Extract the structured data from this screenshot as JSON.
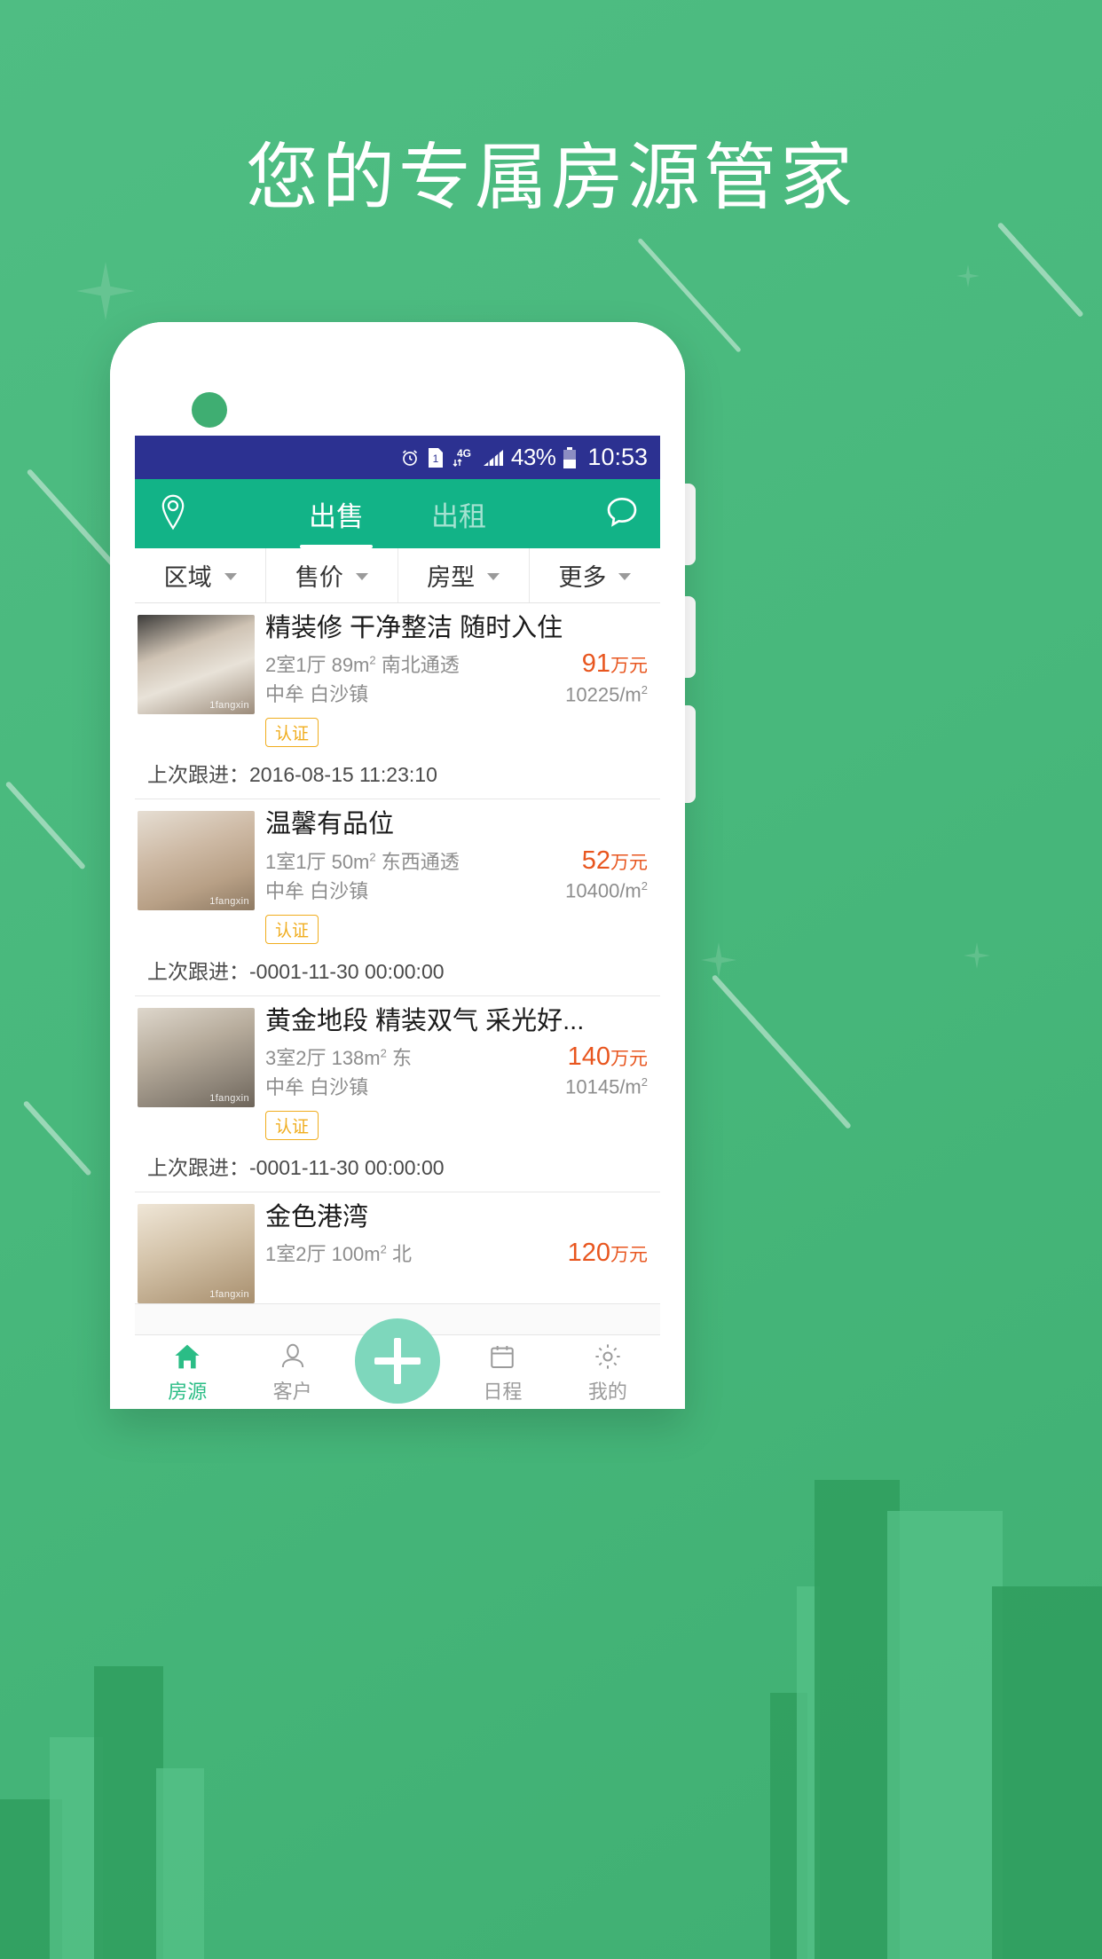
{
  "promo": {
    "headline": "您的专属房源管家"
  },
  "statusbar": {
    "alarm_icon": "alarm-clock-icon",
    "sim_icon": "sim-card-1-icon",
    "network_label": "4G",
    "signal_icon": "signal-bars-icon",
    "battery_percent": "43%",
    "battery_icon": "battery-icon",
    "time": "10:53"
  },
  "appbar": {
    "location_icon": "map-pin-icon",
    "message_icon": "chat-bubble-icon",
    "tabs": [
      {
        "label": "出售",
        "active": true
      },
      {
        "label": "出租",
        "active": false
      }
    ]
  },
  "filters": [
    {
      "label": "区域",
      "icon": "chevron-down-icon"
    },
    {
      "label": "售价",
      "icon": "chevron-down-icon"
    },
    {
      "label": "房型",
      "icon": "chevron-down-icon"
    },
    {
      "label": "更多",
      "icon": "chevron-down-icon"
    }
  ],
  "listings": [
    {
      "title": "精装修 干净整洁 随时入住",
      "spec": "2室1厅 89m",
      "spec_sup": "2",
      "spec_tail": " 南北通透",
      "price": "91",
      "price_unit": "万元",
      "location": "中牟 白沙镇",
      "unit_price": "10225/m",
      "unit_price_sup": "2",
      "badge": "认证",
      "watermark": "1fangxin",
      "followup": "上次跟进：2016-08-15 11:23:10"
    },
    {
      "title": "温馨有品位",
      "spec": "1室1厅 50m",
      "spec_sup": "2",
      "spec_tail": " 东西通透",
      "price": "52",
      "price_unit": "万元",
      "location": "中牟 白沙镇",
      "unit_price": "10400/m",
      "unit_price_sup": "2",
      "badge": "认证",
      "watermark": "1fangxin",
      "followup": "上次跟进：-0001-11-30 00:00:00"
    },
    {
      "title": "黄金地段 精装双气 采光好...",
      "spec": "3室2厅 138m",
      "spec_sup": "2",
      "spec_tail": " 东",
      "price": "140",
      "price_unit": "万元",
      "location": "中牟 白沙镇",
      "unit_price": "10145/m",
      "unit_price_sup": "2",
      "badge": "认证",
      "watermark": "1fangxin",
      "followup": "上次跟进：-0001-11-30 00:00:00"
    },
    {
      "title": "金色港湾",
      "spec": "1室2厅 100m",
      "spec_sup": "2",
      "spec_tail": " 北",
      "price": "120",
      "price_unit": "万元",
      "location": "",
      "unit_price": "",
      "unit_price_sup": "",
      "badge": "",
      "watermark": "1fangxin",
      "followup": ""
    }
  ],
  "bottomnav": {
    "items": [
      {
        "label": "房源",
        "icon": "home-icon",
        "active": true
      },
      {
        "label": "客户",
        "icon": "person-icon",
        "active": false
      },
      {
        "label": "日程",
        "icon": "calendar-icon",
        "active": false
      },
      {
        "label": "我的",
        "icon": "gear-icon",
        "active": false
      }
    ],
    "fab_icon": "plus-icon"
  },
  "colors": {
    "brand_green": "#4cb87b",
    "appbar_green": "#12b387",
    "statusbar_blue": "#2c3191",
    "price_orange": "#e8561f",
    "badge_orange": "#f0ad1e",
    "fab_mint": "#7ed7bc",
    "active_nav": "#2bbd86"
  }
}
